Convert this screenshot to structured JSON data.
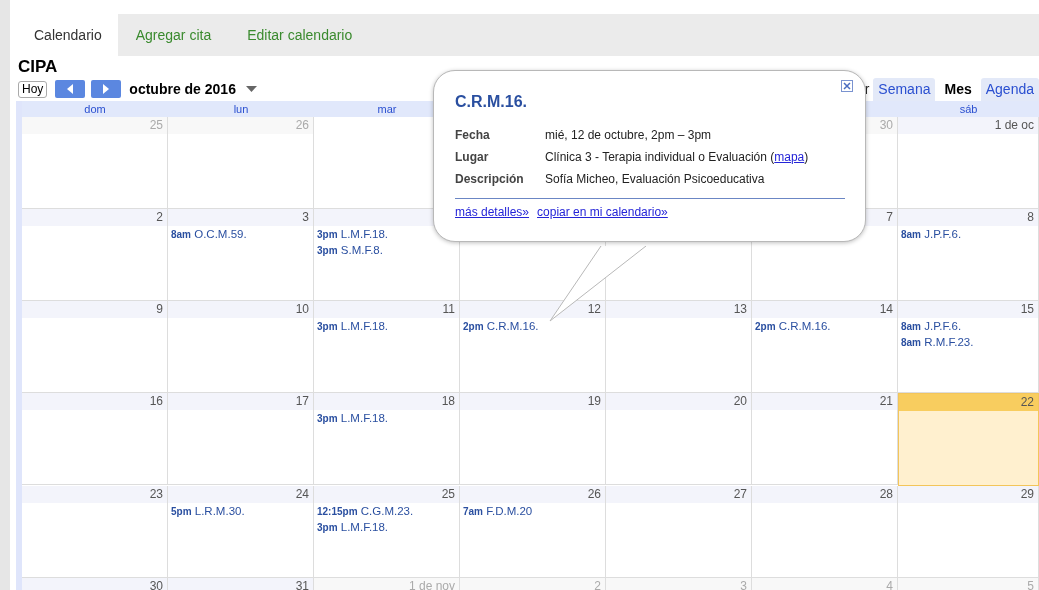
{
  "tabs": [
    {
      "label": "Calendario",
      "selected": true
    },
    {
      "label": "Agregar cita",
      "selected": false
    },
    {
      "label": "Editar calendario",
      "selected": false
    }
  ],
  "calendar_name": "CIPA",
  "today_button": "Hoy",
  "month_title": "octubre de 2016",
  "view_fragment": "r",
  "views": [
    {
      "label": "Semana",
      "selected": false
    },
    {
      "label": "Mes",
      "selected": true
    },
    {
      "label": "Agenda",
      "selected": false
    }
  ],
  "weekdays": {
    "before_popup": [
      {
        "label": "dom"
      },
      {
        "label": "lun"
      },
      {
        "label": "mar"
      }
    ],
    "after_popup": [
      {
        "label": "sáb"
      }
    ]
  },
  "weeks": [
    {
      "before_popup": [
        {
          "label": "25",
          "other_month": true
        },
        {
          "label": "26",
          "other_month": true
        }
      ],
      "after_popup": [
        {
          "label": "30",
          "other_month": true
        },
        {
          "label": "1 de oc"
        }
      ]
    },
    {
      "before_popup": [
        {
          "label": "2"
        },
        {
          "label": "3",
          "events": [
            {
              "time": "8am",
              "title": "O.C.M.59."
            }
          ]
        },
        {
          "events": [
            {
              "time": "3pm",
              "title": "L.M.F.18."
            },
            {
              "time": "3pm",
              "title": "S.M.F.8."
            }
          ]
        }
      ],
      "after_popup": [
        {
          "label": "7"
        },
        {
          "label": "8",
          "events": [
            {
              "time": "8am",
              "title": "J.P.F.6."
            }
          ]
        }
      ]
    },
    [
      {
        "label": "9"
      },
      {
        "label": "10"
      },
      {
        "label": "11",
        "events": [
          {
            "time": "3pm",
            "title": "L.M.F.18."
          }
        ]
      },
      {
        "label": "12",
        "events": [
          {
            "time": "2pm",
            "title": "C.R.M.16."
          }
        ]
      },
      {
        "label": "13"
      },
      {
        "label": "14",
        "events": [
          {
            "time": "2pm",
            "title": "C.R.M.16."
          }
        ]
      },
      {
        "label": "15",
        "events": [
          {
            "time": "8am",
            "title": "J.P.F.6."
          },
          {
            "time": "8am",
            "title": "R.M.F.23."
          }
        ]
      }
    ],
    [
      {
        "label": "16"
      },
      {
        "label": "17"
      },
      {
        "label": "18",
        "events": [
          {
            "time": "3pm",
            "title": "L.M.F.18."
          }
        ]
      },
      {
        "label": "19"
      },
      {
        "label": "20"
      },
      {
        "label": "21"
      },
      {
        "label": "22",
        "today": true
      }
    ],
    [
      {
        "label": "23"
      },
      {
        "label": "24",
        "events": [
          {
            "time": "5pm",
            "title": "L.R.M.30."
          }
        ]
      },
      {
        "label": "25",
        "events": [
          {
            "time": "12:15pm",
            "title": "C.G.M.23."
          },
          {
            "time": "3pm",
            "title": "L.M.F.18."
          }
        ]
      },
      {
        "label": "26",
        "events": [
          {
            "time": "7am",
            "title": "F.D.M.20"
          }
        ]
      },
      {
        "label": "27"
      },
      {
        "label": "28"
      },
      {
        "label": "29"
      }
    ],
    [
      {
        "label": "30"
      },
      {
        "label": "31"
      },
      {
        "label": "1 de nov",
        "other_month": true
      },
      {
        "label": "2",
        "other_month": true
      },
      {
        "label": "3",
        "other_month": true
      },
      {
        "label": "4",
        "other_month": true
      },
      {
        "label": "5",
        "other_month": true
      }
    ]
  ],
  "popup": {
    "title": "C.R.M.16.",
    "rows": [
      {
        "label": "Fecha",
        "value": "mié, 12 de octubre, 2pm – 3pm"
      },
      {
        "label": "Lugar",
        "value": "Clínica 3 - Terapia individual o Evaluación (",
        "link": "mapa",
        "after": ")"
      },
      {
        "label": "Descripción",
        "value": "Sofía Micheo, Evaluación Psicoeducativa"
      }
    ],
    "links": [
      "más detalles»",
      "copiar en mi calendario»"
    ]
  }
}
